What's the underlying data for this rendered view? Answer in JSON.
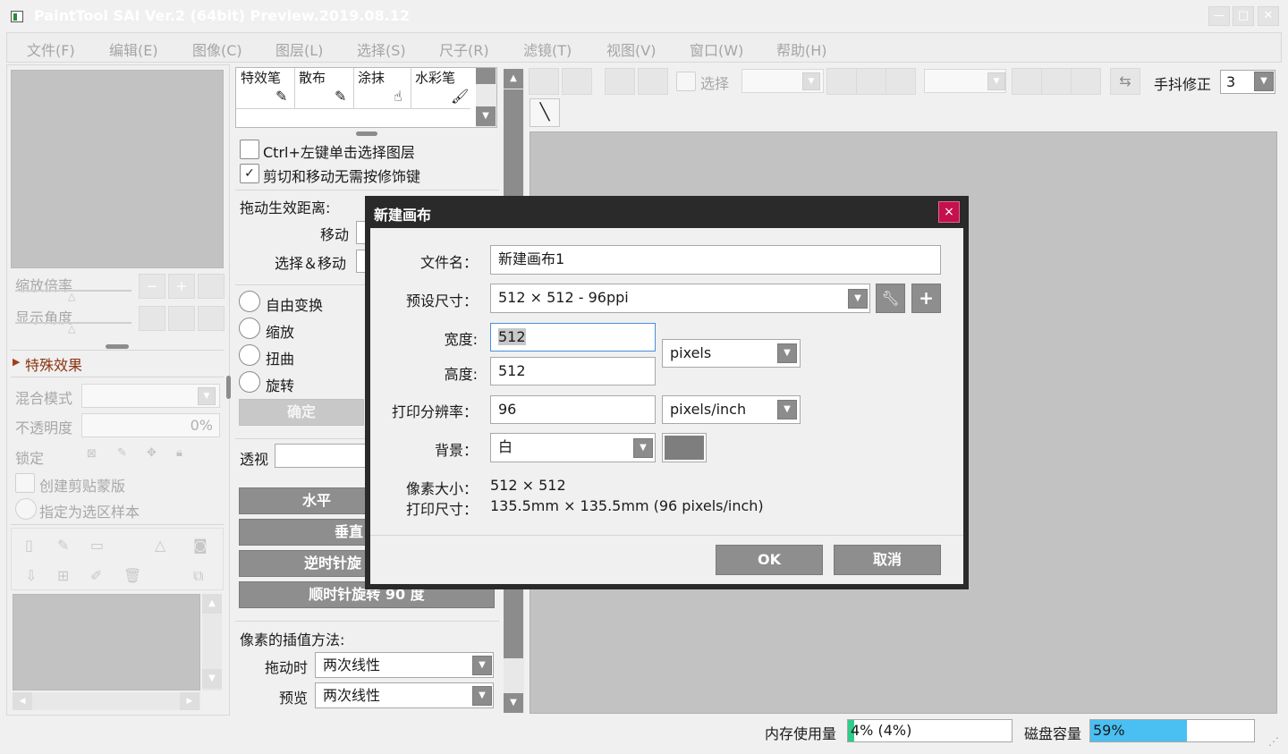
{
  "window": {
    "title": "PaintTool SAI Ver.2 (64bit) Preview.2019.08.12"
  },
  "window_controls": {
    "minimize": "—",
    "maximize": "□",
    "close": "✕"
  },
  "menu": [
    "文件(F)",
    "编辑(E)",
    "图像(C)",
    "图层(L)",
    "选择(S)",
    "尺子(R)",
    "滤镜(T)",
    "视图(V)",
    "窗口(W)",
    "帮助(H)"
  ],
  "navigator": {
    "zoom_label": "缩放倍率",
    "angle_label": "显示角度"
  },
  "layer_panel": {
    "effects_label": "特殊效果",
    "blend_label": "混合模式",
    "opacity_label": "不透明度",
    "opacity_value": "0%",
    "lock_label": "锁定",
    "clip_label": "创建剪贴蒙版",
    "sample_label": "指定为选区样本"
  },
  "brushes": [
    "特效笔",
    "散布",
    "涂抹",
    "水彩笔"
  ],
  "tool_options": {
    "ctrl_select": "Ctrl+左键单击选择图层",
    "cut_move": "剪切和移动无需按修饰键",
    "drag_distance": "拖动生效距离:",
    "move": "移动",
    "select_move": "选择＆移动",
    "free_transform": "自由变换",
    "scale": "缩放",
    "distort": "扭曲",
    "rotate": "旋转",
    "ok": "确定",
    "perspective": "透视",
    "flip_h": "水平",
    "flip_v": "垂直",
    "rotate_ccw": "逆时针旋",
    "rotate_cw": "顺时针旋转 90 度",
    "interp_label": "像素的插值方法:",
    "drag_time": "拖动时",
    "drag_method": "两次线性",
    "preview": "预览",
    "preview_method": "两次线性"
  },
  "toolbar": {
    "select_label": "选择",
    "stabilizer_label": "手抖修正",
    "stabilizer_value": "3"
  },
  "status": {
    "memory_label": "内存使用量",
    "memory_value": "4% (4%)",
    "memory_fill": 0.04,
    "disk_label": "磁盘容量",
    "disk_value": "59%",
    "disk_fill": 0.59
  },
  "dialog": {
    "title": "新建画布",
    "close": "×",
    "filename_label": "文件名：",
    "filename_value": "新建画布1",
    "preset_label": "预设尺寸：",
    "preset_value": "512 × 512 - 96ppi",
    "width_label": "宽度:",
    "width_value": "512",
    "height_label": "高度:",
    "height_value": "512",
    "size_unit": "pixels",
    "resolution_label": "打印分辨率：",
    "resolution_value": "96",
    "resolution_unit": "pixels/inch",
    "background_label": "背景：",
    "background_value": "白",
    "pixel_size_label": "像素大小：",
    "pixel_size_value": "512 × 512",
    "print_size_label": "打印尺寸：",
    "print_size_value": "135.5mm × 135.5mm (96 pixels/inch)",
    "ok": "OK",
    "cancel": "取消"
  },
  "icons": {
    "wrench": "wrench-icon",
    "plus": "plus-icon",
    "brush": "brush-icon",
    "line": "line-tool-icon"
  }
}
